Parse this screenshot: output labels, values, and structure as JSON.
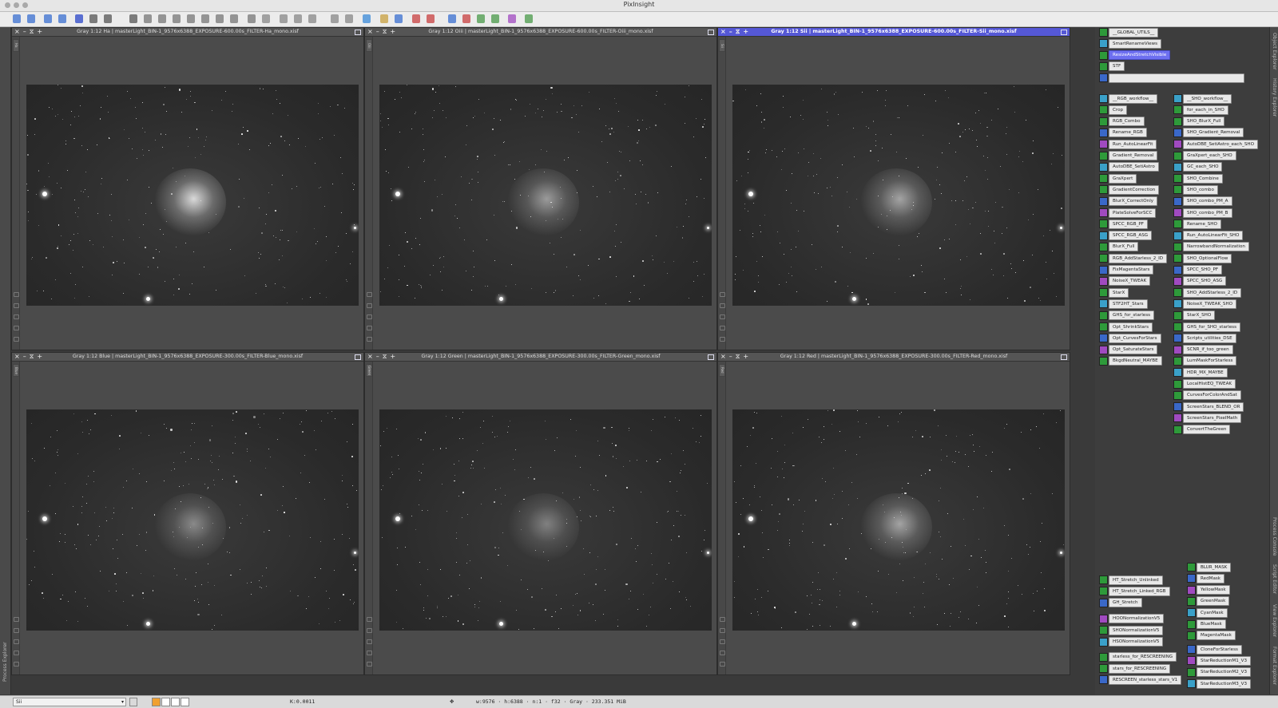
{
  "app": {
    "title": "PixInsight"
  },
  "docks": {
    "left_tabs": [
      "Process Explorer"
    ],
    "right_tabs": [
      "Object Explorer",
      "History Explorer",
      "Process Console",
      "Script Editor",
      "View Explorer",
      "Format Explorer"
    ]
  },
  "windows": [
    {
      "title": "Gray 1:12 Ha | masterLight_BIN-1_9576x6388_EXPOSURE-600.00s_FILTER-Ha_mono.xisf",
      "tab": "Ha",
      "active": false
    },
    {
      "title": "Gray 1:12 Oiii | masterLight_BIN-1_9576x6388_EXPOSURE-600.00s_FILTER-Oiii_mono.xisf",
      "tab": "Oiii",
      "active": false
    },
    {
      "title": "Gray 1:12 Sii | masterLight_BIN-1_9576x6388_EXPOSURE-600.00s_FILTER-Sii_mono.xisf",
      "tab": "Sii",
      "active": true
    },
    {
      "title": "Gray 1:12 Blue | masterLight_BIN-1_9576x6388_EXPOSURE-300.00s_FILTER-Blue_mono.xisf",
      "tab": "Blue",
      "active": false
    },
    {
      "title": "Gray 1:12 Green | masterLight_BIN-1_9576x6388_EXPOSURE-300.00s_FILTER-Green_mono.xisf",
      "tab": "Green",
      "active": false
    },
    {
      "title": "Gray 1:12 Red | masterLight_BIN-1_9576x6388_EXPOSURE-300.00s_FILTER-Red_mono.xisf",
      "tab": "Red",
      "active": false
    }
  ],
  "icons": {
    "top": [
      "__GLOBAL_UTILS__",
      "SmartRenameViews",
      "ResizeAndStretchVisible",
      "STF",
      ""
    ],
    "top_selected": "ResizeAndStretchVisible",
    "col1": [
      "__RGB_workflow__",
      "Crop",
      "RGB_Combo",
      "Rename_RGB",
      "Run_AutoLinearFit",
      "Gradient_Removal",
      "AutoDBE_SetiAstro",
      "GraXpert",
      "GradientCorrection",
      "BlurX_CorrectOnly",
      "PlateSolveForSCC",
      "SPCC_RGB_PF",
      "SPCC_RGB_ASG",
      "BlurX_Full",
      "RGB_AddStarless_2_ID",
      "FixMagentaStars",
      "NoiseX_TWEAK",
      "StarX",
      "STF2HT_Stars",
      "GHS_for_starless",
      "Opt_ShrinkStars",
      "Opt_CurvesForStars",
      "Opt_SaturateStars",
      "BkgdNeutral_MAYBE"
    ],
    "col2": [
      "__SHO_workflow__",
      "for_each_in_SHO",
      "SHO_BlurX_Full",
      "SHO_Gradient_Removal",
      "AutoDBE_SetiAstro_each_SHO",
      "GraXpert_each_SHO",
      "GC_each_SHO",
      "SHO_Combine",
      "SHO_combo",
      "SHO_combo_PM_A",
      "SHO_combo_PM_B",
      "Rename_SHO",
      "Run_AutoLinearFit_SHO",
      "NarrowbandNormalization",
      "SHO_OptionalFlow",
      "SPCC_SHO_PF",
      "SPCC_SHO_ASG",
      "SHO_AddStarless_2_ID",
      "NoiseX_TWEAK_SHO",
      "StarX_SHO",
      "GHS_for_SHO_starless",
      "Scripts_utilities_DSE",
      "SCNR_if_too_green",
      "LumMaskForStarless",
      "HDR_MX_MAYBE",
      "LocalHistEQ_TWEAK",
      "CurvesForColorAndSat",
      "ScreenStars_BLEND_OR",
      "ScreenStars_PixelMath",
      "ConvertTheGreen"
    ],
    "bottom_left": [
      "HT_Stretch_Unlinked",
      "HT_Stretch_Linked_RGB",
      "GH_Stretch",
      "HOONormalizationV5",
      "SHONormalizationV5",
      "HSONormalizationV5",
      "starless_for_RESCREENING",
      "stars_for_RESCREENING",
      "RESCREEN_starless_stars_V1"
    ],
    "bottom_right": [
      "BLUR_MASK",
      "RedMask",
      "YellowMask",
      "GreenMask",
      "CyanMask",
      "BlueMask",
      "MagentaMask",
      "CloneForStarless",
      "StarReductionM1_V3",
      "StarReductionM2_V3",
      "StarReductionM3_V3"
    ]
  },
  "status": {
    "view_selector": "Sii",
    "readout": "K:0.0011",
    "info": "w:9576 · h:6388 · n:1 · f32 · Gray · 233.351 MiB"
  }
}
